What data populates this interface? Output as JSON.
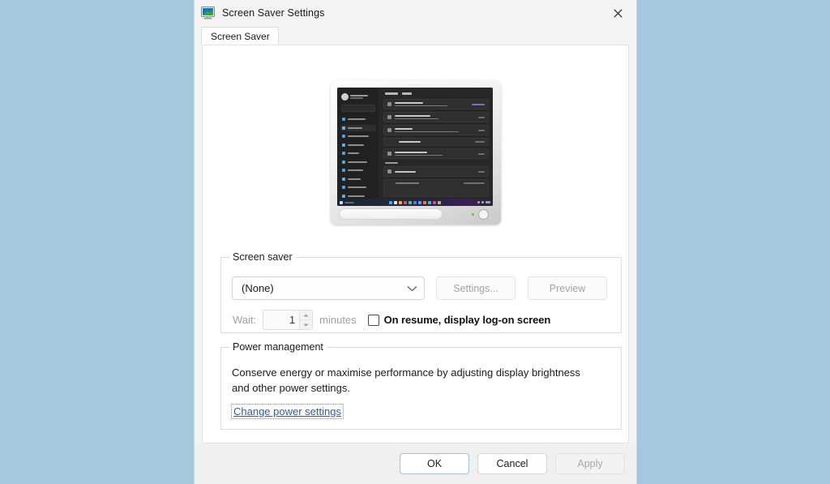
{
  "window": {
    "title": "Screen Saver Settings",
    "icon": "screen-saver-monitor-icon",
    "close_label": "✕",
    "background_color": "#a6c8dc"
  },
  "tabs": [
    {
      "label": "Screen Saver",
      "selected": true
    }
  ],
  "preview": {
    "name": "monitor-preview",
    "screen_mode": "windows-dark-settings-system-power"
  },
  "screen_saver_group": {
    "label": "Screen saver",
    "dropdown": {
      "value": "(None)",
      "chevron": "chevron-down-icon"
    },
    "settings_button": {
      "label": "Settings...",
      "disabled": true
    },
    "preview_button": {
      "label": "Preview",
      "disabled": true
    },
    "wait_label": "Wait:",
    "wait_value": "1",
    "minutes_label": "minutes",
    "resume_checkbox": {
      "label": "On resume, display log-on screen",
      "checked": false
    }
  },
  "power_group": {
    "label": "Power management",
    "description": "Conserve energy or maximise performance by adjusting display brightness and other power settings.",
    "link": "Change power settings",
    "link_color": "#2a5db0"
  },
  "footer": {
    "ok_label": "OK",
    "cancel_label": "Cancel",
    "apply_label": "Apply",
    "apply_disabled": true
  }
}
